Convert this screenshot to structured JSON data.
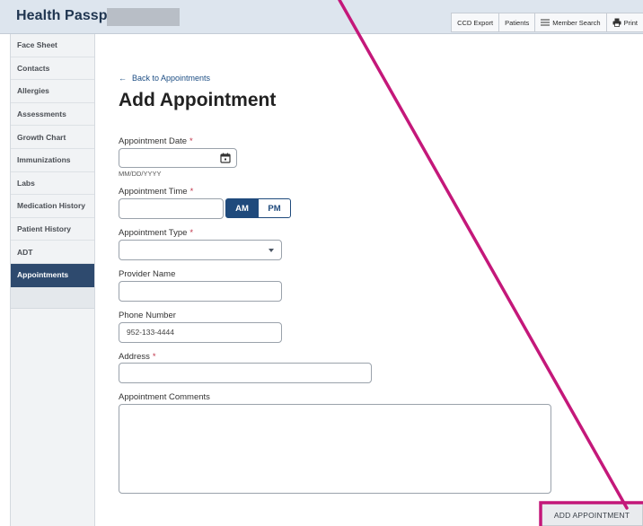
{
  "header": {
    "app_title": "Health Passport:",
    "toolbar": [
      {
        "label": "CCD Export",
        "icon": ""
      },
      {
        "label": "Patients",
        "icon": ""
      },
      {
        "label": "Member Search",
        "icon": "hamburger-icon"
      },
      {
        "label": "Print",
        "icon": "printer-icon"
      }
    ]
  },
  "sidebar": {
    "items": [
      {
        "label": "Face Sheet"
      },
      {
        "label": "Contacts"
      },
      {
        "label": "Allergies"
      },
      {
        "label": "Assessments"
      },
      {
        "label": "Growth Chart"
      },
      {
        "label": "Immunizations"
      },
      {
        "label": "Labs"
      },
      {
        "label": "Medication History"
      },
      {
        "label": "Patient History"
      },
      {
        "label": "ADT"
      },
      {
        "label": "Appointments",
        "active": true
      }
    ]
  },
  "main": {
    "back_link": "Back to Appointments",
    "back_arrow": "←",
    "title": "Add Appointment",
    "required_mark": "*",
    "fields": {
      "date": {
        "label": "Appointment Date",
        "hint": "MM/DD/YYYY",
        "value": ""
      },
      "time": {
        "label": "Appointment Time",
        "value": "",
        "am": "AM",
        "pm": "PM",
        "selected": "AM"
      },
      "type": {
        "label": "Appointment Type",
        "value": ""
      },
      "provider": {
        "label": "Provider Name",
        "value": ""
      },
      "phone": {
        "label": "Phone Number",
        "value": "952-133-4444"
      },
      "address": {
        "label": "Address",
        "value": ""
      },
      "comments": {
        "label": "Appointment Comments",
        "value": ""
      }
    },
    "submit_label": "ADD APPOINTMENT"
  },
  "colors": {
    "header_bg": "#dde5ee",
    "sidebar_active": "#2e4a6e",
    "primary": "#1f4a7c",
    "annotation": "#c4187a",
    "required": "#c0344a"
  }
}
